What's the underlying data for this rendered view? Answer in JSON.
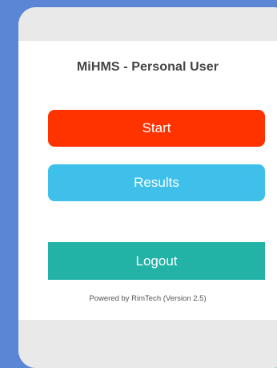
{
  "app": {
    "title": "MiHMS - Personal User"
  },
  "buttons": {
    "start_label": "Start",
    "results_label": "Results",
    "logout_label": "Logout"
  },
  "footer": {
    "powered_by": "Powered by RimTech (Version 2.5)"
  },
  "colors": {
    "background": "#5b86d6",
    "start": "#ff3300",
    "results": "#3fc0ea",
    "logout": "#22b2a6"
  }
}
